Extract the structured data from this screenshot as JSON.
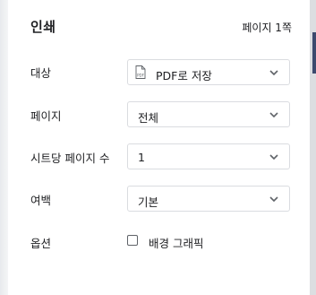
{
  "header": {
    "title": "인쇄",
    "page_count": "페이지 1쪽"
  },
  "settings": {
    "destination": {
      "label": "대상",
      "value": "PDF로 저장",
      "icon": "pdf-file-icon"
    },
    "pages": {
      "label": "페이지",
      "value": "전체"
    },
    "pages_per_sheet": {
      "label": "시트당 페이지 수",
      "value": "1"
    },
    "margins": {
      "label": "여백",
      "value": "기본"
    },
    "options": {
      "label": "옵션",
      "background_graphics_label": "배경 그래픽",
      "background_graphics_checked": false
    }
  }
}
